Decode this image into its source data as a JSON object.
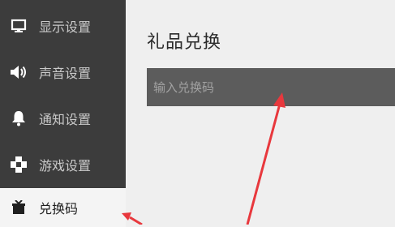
{
  "sidebar": {
    "items": [
      {
        "label": "显示设置",
        "icon": "monitor-icon"
      },
      {
        "label": "声音设置",
        "icon": "speaker-icon"
      },
      {
        "label": "通知设置",
        "icon": "bell-icon"
      },
      {
        "label": "游戏设置",
        "icon": "gamepad-icon"
      },
      {
        "label": "兑换码",
        "icon": "gift-icon",
        "active": true
      }
    ]
  },
  "main": {
    "title": "礼品兑换",
    "input": {
      "placeholder": "输入兑换码",
      "value": ""
    }
  },
  "colors": {
    "sidebar_bg": "#3c3c3c",
    "content_bg": "#efefef",
    "input_bg": "#5c5c5c",
    "annotation_arrow": "#e8383d"
  }
}
